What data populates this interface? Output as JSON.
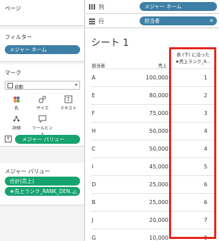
{
  "panels": {
    "pages_title": "ページ",
    "filters_title": "フィルター",
    "marks_title": "マーク",
    "measure_values_title": "メジャー バリュー"
  },
  "filters": {
    "pill": "メジャー ネーム"
  },
  "marks": {
    "type_label": "自動",
    "buttons": [
      "色",
      "サイズ",
      "テキスト",
      "詳細",
      "ツールヒント"
    ],
    "measure_pill": "メジャー バリュー"
  },
  "measure_values": {
    "pills": [
      "合計(売上)",
      "★売上ランク_RANK_DEN..."
    ]
  },
  "shelves": {
    "columns_label": "列",
    "columns_pill": "メジャー ネーム",
    "rows_label": "行",
    "rows_pill": "担当者"
  },
  "sheet": {
    "title": "シート 1",
    "headers": {
      "name": "担当者",
      "sales": "売上",
      "rank_line1": "表 (下) に沿った",
      "rank_line2": "★売上ランク_R..."
    },
    "rows": [
      {
        "name": "A",
        "sales": "100,000",
        "rank": "1"
      },
      {
        "name": "E",
        "sales": "80,000",
        "rank": "2"
      },
      {
        "name": "F",
        "sales": "75,000",
        "rank": "3"
      },
      {
        "name": "H",
        "sales": "50,000",
        "rank": "4"
      },
      {
        "name": "C",
        "sales": "50,000",
        "rank": "4"
      },
      {
        "name": "I",
        "sales": "45,000",
        "rank": "5"
      },
      {
        "name": "D",
        "sales": "25,000",
        "rank": "6"
      },
      {
        "name": "B",
        "sales": "25,000",
        "rank": "6"
      },
      {
        "name": "J",
        "sales": "20,000",
        "rank": "7"
      },
      {
        "name": "G",
        "sales": "10,000",
        "rank": "8"
      }
    ]
  },
  "colors": {
    "blue_pill": "#3d7fa6",
    "green_pill": "#16a370",
    "highlight": "#e8231b"
  }
}
